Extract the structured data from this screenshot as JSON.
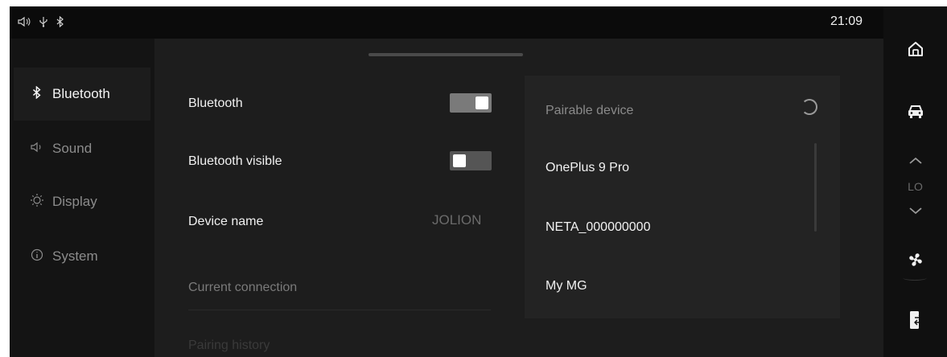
{
  "status_bar": {
    "icons": [
      "volume-icon",
      "usb-icon",
      "bluetooth-icon"
    ],
    "time": "21:09"
  },
  "nav": {
    "items": [
      {
        "label": "Bluetooth",
        "icon": "bluetooth-icon",
        "active": true
      },
      {
        "label": "Sound",
        "icon": "speaker-icon",
        "active": false
      },
      {
        "label": "Display",
        "icon": "brightness-icon",
        "active": false
      },
      {
        "label": "System",
        "icon": "info-icon",
        "active": false
      }
    ]
  },
  "settings": {
    "bluetooth_label": "Bluetooth",
    "bluetooth_on": true,
    "visible_label": "Bluetooth visible",
    "visible_on": false,
    "device_name_label": "Device name",
    "device_name_value": "JOLION",
    "current_connection_label": "Current connection",
    "pairing_history_label": "Pairing history"
  },
  "pairable": {
    "title": "Pairable device",
    "devices": [
      "OnePlus 9 Pro",
      "NETA_000000000",
      "My MG"
    ]
  },
  "rail": {
    "temp_label": "LO",
    "buttons": [
      "home-icon",
      "car-icon",
      "temp-up-icon",
      "temp-down-icon",
      "fan-icon",
      "phone-link-icon"
    ]
  },
  "colors": {
    "background": "#151515",
    "panel": "#232323",
    "toggle_on": "#7a7a7a",
    "toggle_off": "#555555"
  }
}
